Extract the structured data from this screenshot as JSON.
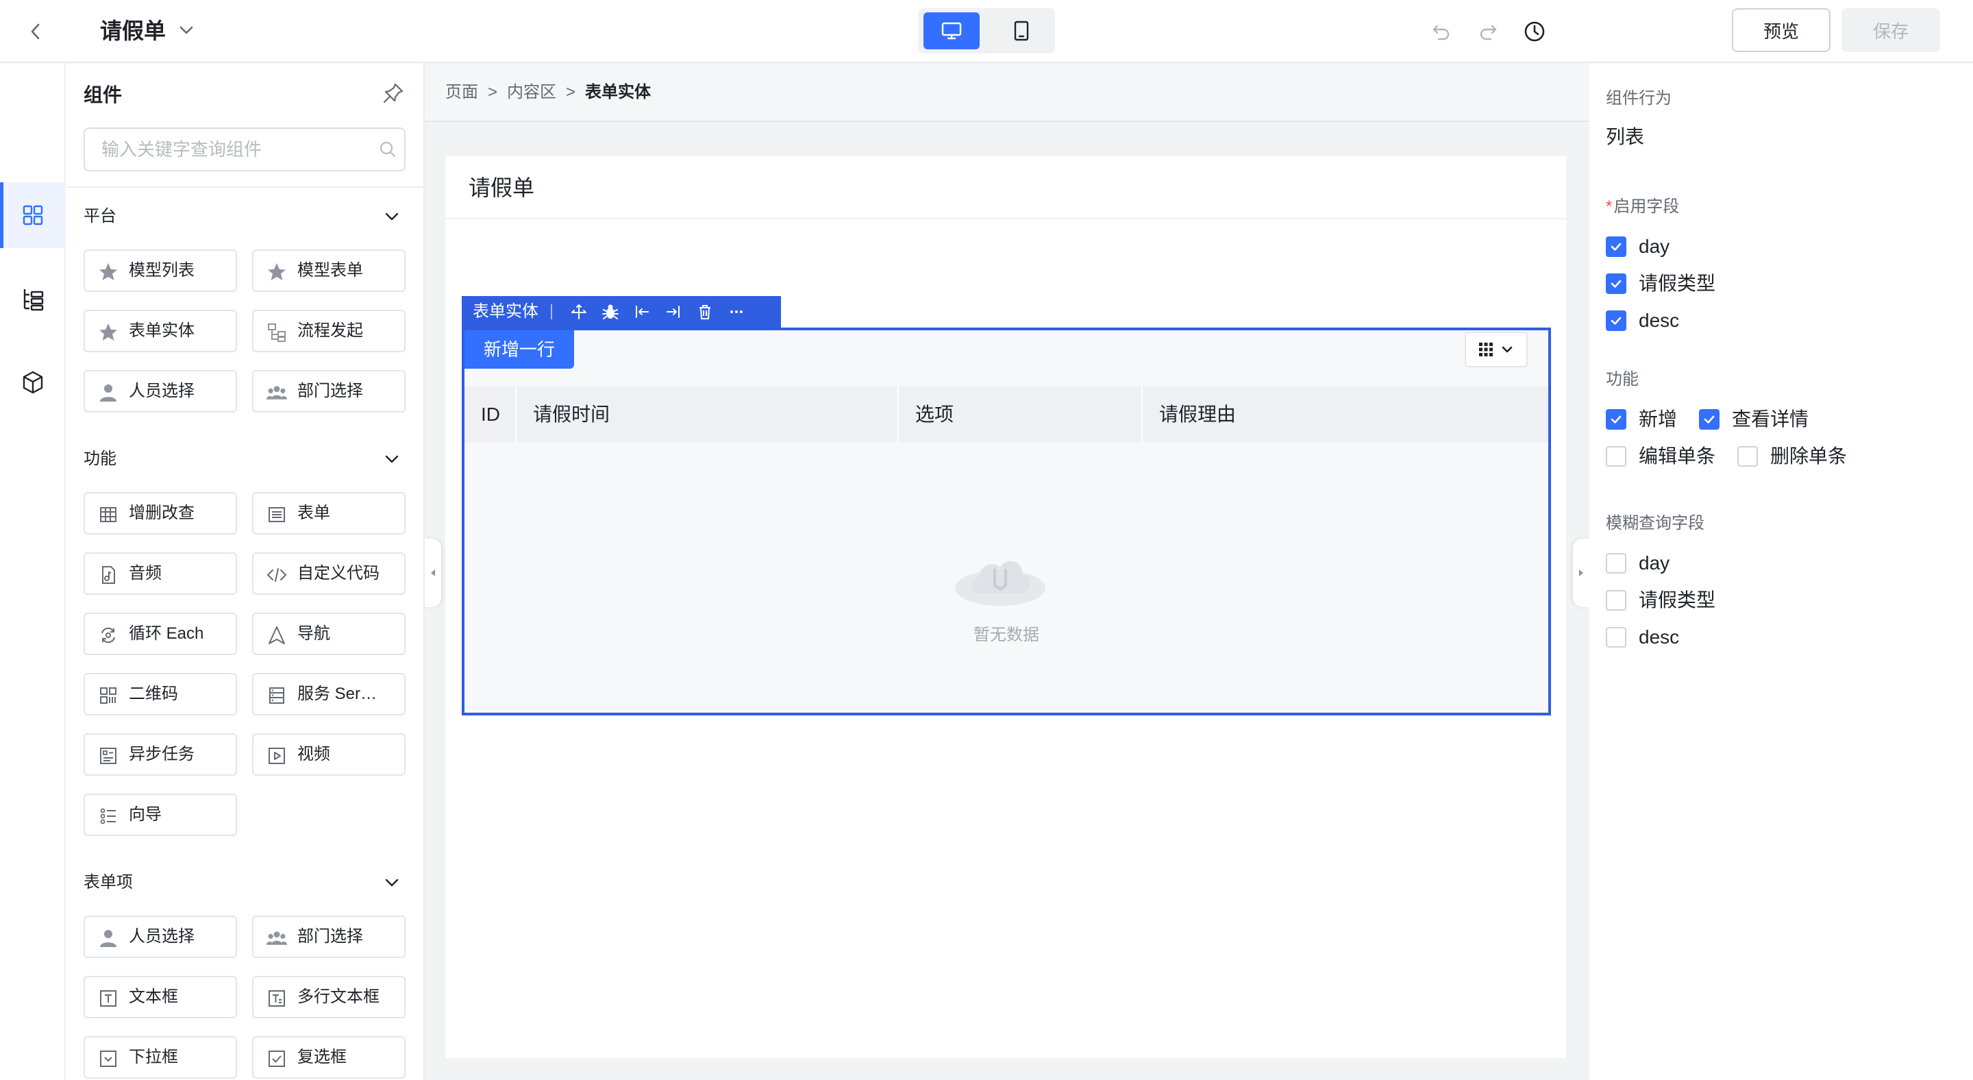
{
  "header": {
    "title": "请假单",
    "preview_label": "预览",
    "save_label": "保存"
  },
  "colors": {
    "primary": "#3370ff",
    "selection": "#2f5ee0",
    "required": "#f54a45"
  },
  "component_panel": {
    "title": "组件",
    "search_placeholder": "输入关键字查询组件",
    "sections": [
      {
        "title": "平台",
        "items": [
          {
            "label": "模型列表",
            "icon": "star-icon"
          },
          {
            "label": "模型表单",
            "icon": "star-icon"
          },
          {
            "label": "表单实体",
            "icon": "star-icon"
          },
          {
            "label": "流程发起",
            "icon": "flow-icon"
          },
          {
            "label": "人员选择",
            "icon": "person-icon"
          },
          {
            "label": "部门选择",
            "icon": "group-icon"
          }
        ]
      },
      {
        "title": "功能",
        "items": [
          {
            "label": "增删改查",
            "icon": "table-grid-icon"
          },
          {
            "label": "表单",
            "icon": "form-icon"
          },
          {
            "label": "音频",
            "icon": "audio-file-icon"
          },
          {
            "label": "自定义代码",
            "icon": "code-icon"
          },
          {
            "label": "循环 Each",
            "icon": "loop-icon"
          },
          {
            "label": "导航",
            "icon": "navigation-icon"
          },
          {
            "label": "二维码",
            "icon": "qrcode-icon"
          },
          {
            "label": "服务 Ser…",
            "icon": "service-icon"
          },
          {
            "label": "异步任务",
            "icon": "async-task-icon"
          },
          {
            "label": "视频",
            "icon": "video-icon"
          },
          {
            "label": "向导",
            "icon": "wizard-icon"
          }
        ]
      },
      {
        "title": "表单项",
        "items": [
          {
            "label": "人员选择",
            "icon": "person-icon"
          },
          {
            "label": "部门选择",
            "icon": "group-icon"
          },
          {
            "label": "文本框",
            "icon": "text-input-icon"
          },
          {
            "label": "多行文本框",
            "icon": "textarea-icon"
          },
          {
            "label": "下拉框",
            "icon": "dropdown-icon"
          },
          {
            "label": "复选框",
            "icon": "checkbox-icon"
          }
        ]
      }
    ]
  },
  "breadcrumb": [
    "页面",
    "内容区",
    "表单实体"
  ],
  "breadcrumb_separator": ">",
  "canvas": {
    "card_title": "请假单",
    "selected_component": "表单实体",
    "add_row_label": "新增一行",
    "columns": [
      "ID",
      "请假时间",
      "选项",
      "请假理由"
    ],
    "empty_text": "暂无数据"
  },
  "properties": {
    "behavior_label": "组件行为",
    "behavior_value": "列表",
    "enabled_fields_label": "启用字段",
    "required_mark": "*",
    "enabled_fields": [
      {
        "label": "day",
        "checked": true
      },
      {
        "label": "请假类型",
        "checked": true
      },
      {
        "label": "desc",
        "checked": true
      }
    ],
    "features_label": "功能",
    "features": [
      {
        "label": "新增",
        "checked": true
      },
      {
        "label": "查看详情",
        "checked": true
      },
      {
        "label": "编辑单条",
        "checked": false
      },
      {
        "label": "删除单条",
        "checked": false
      }
    ],
    "fuzzy_label": "模糊查询字段",
    "fuzzy_fields": [
      {
        "label": "day",
        "checked": false
      },
      {
        "label": "请假类型",
        "checked": false
      },
      {
        "label": "desc",
        "checked": false
      }
    ]
  }
}
